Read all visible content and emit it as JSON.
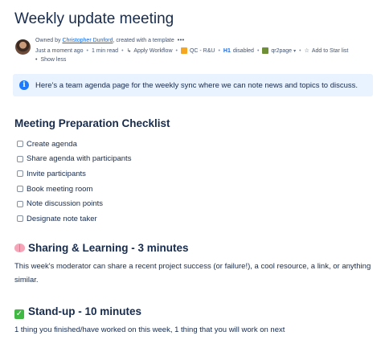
{
  "page": {
    "title": "Weekly update meeting"
  },
  "byline": {
    "owned_by_prefix": "Owned by ",
    "owner_name": "Christopher Dunford",
    "created_suffix": ", created with a template",
    "more_label": "•••",
    "edited": "Just a moment ago",
    "read_time": "1 min read",
    "apply_workflow": "Apply Workflow",
    "qc_label": "QC - R&U",
    "h1_label": "H1",
    "h1_status": "disabled",
    "qr_label": "qr2page",
    "star_label": "Add to Star list",
    "show_less": "Show less"
  },
  "info_panel": {
    "icon": "info-icon",
    "text": "Here's a team agenda page for the weekly sync where we can note news and topics to discuss."
  },
  "checklist": {
    "heading": "Meeting Preparation Checklist",
    "items": [
      "Create agenda",
      "Share agenda with participants",
      "Invite participants",
      "Book meeting room",
      "Note discussion points",
      "Designate note taker"
    ]
  },
  "sharing": {
    "icon": "brain-emoji",
    "heading": "Sharing & Learning - 3 minutes",
    "line1": "This week's moderator can share a recent project success (or failure!), a cool resource, a link, or anything",
    "line2": "similar."
  },
  "standup": {
    "icon": "check-mark-emoji",
    "heading": "Stand-up - 10 minutes",
    "text": "1 thing you finished/have worked on this week, 1 thing that you will work on next"
  },
  "colors": {
    "text": "#172b4d",
    "link": "#0c66e4",
    "info_bg": "#e9f2ff",
    "info_icon": "#1d7afc",
    "check_emoji": "#40b843"
  }
}
